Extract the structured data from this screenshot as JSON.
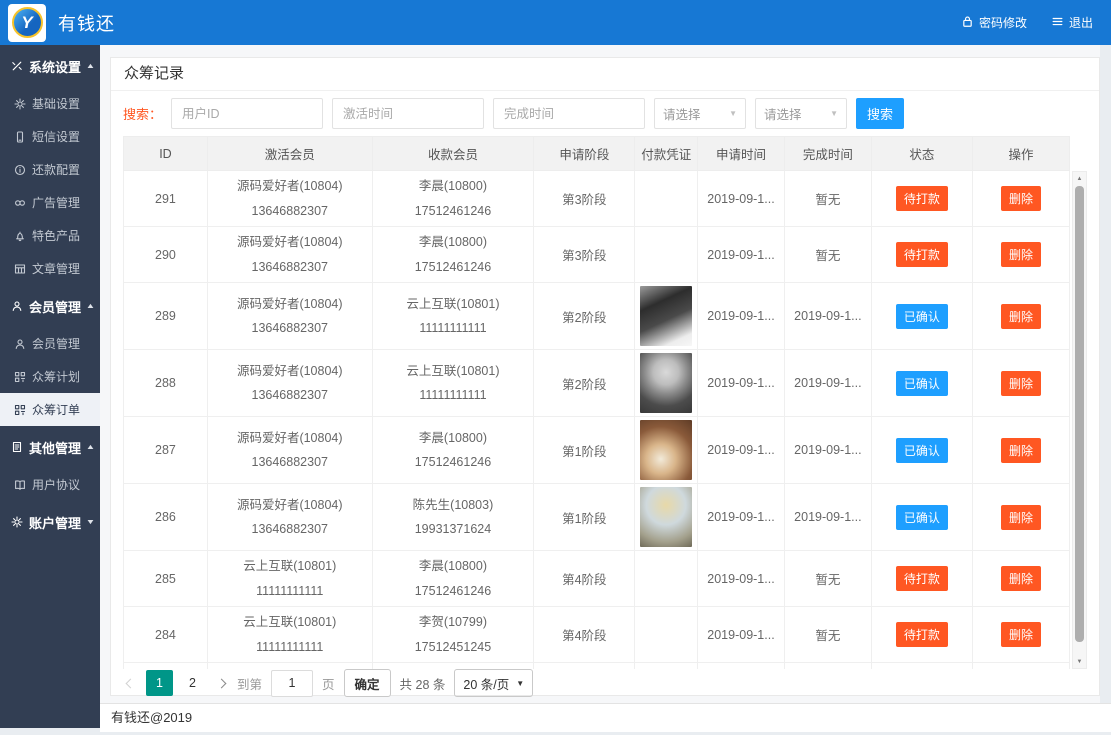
{
  "header": {
    "title": "有钱还",
    "logo_letter": "Y",
    "actions": [
      {
        "key": "change-password",
        "label": "密码修改",
        "icon": "lock-icon"
      },
      {
        "key": "logout",
        "label": "退出",
        "icon": "menu-icon"
      }
    ]
  },
  "sidebar": {
    "items": [
      {
        "key": "system-settings",
        "label": "系统设置",
        "type": "section",
        "icon": "tools",
        "arrow": "up"
      },
      {
        "key": "basic-settings",
        "label": "基础设置",
        "type": "item",
        "icon": "gear"
      },
      {
        "key": "sms-settings",
        "label": "短信设置",
        "type": "item",
        "icon": "phone"
      },
      {
        "key": "repayment-config",
        "label": "还款配置",
        "type": "item",
        "icon": "info"
      },
      {
        "key": "ad-management",
        "label": "广告管理",
        "type": "item",
        "icon": "link"
      },
      {
        "key": "featured-products",
        "label": "特色产品",
        "type": "item",
        "icon": "bell"
      },
      {
        "key": "article-management",
        "label": "文章管理",
        "type": "item",
        "icon": "grid"
      },
      {
        "key": "member-management-group",
        "label": "会员管理",
        "type": "section",
        "icon": "user",
        "arrow": "up"
      },
      {
        "key": "member-management",
        "label": "会员管理",
        "type": "item",
        "icon": "user"
      },
      {
        "key": "crowdfunding-plan",
        "label": "众筹计划",
        "type": "item",
        "icon": "qr"
      },
      {
        "key": "crowdfunding-orders",
        "label": "众筹订单",
        "type": "item",
        "icon": "qr",
        "active": true
      },
      {
        "key": "other-management",
        "label": "其他管理",
        "type": "section",
        "icon": "doc",
        "arrow": "up"
      },
      {
        "key": "user-agreement",
        "label": "用户协议",
        "type": "item",
        "icon": "book"
      },
      {
        "key": "account-management",
        "label": "账户管理",
        "type": "section",
        "icon": "gear",
        "arrow": "down"
      }
    ]
  },
  "page": {
    "title": "众筹记录"
  },
  "search": {
    "label": "搜索：",
    "inputs": [
      {
        "key": "user-id",
        "placeholder": "用户ID"
      },
      {
        "key": "activate-time",
        "placeholder": "激活时间"
      },
      {
        "key": "finish-time",
        "placeholder": "完成时间"
      }
    ],
    "selects": [
      {
        "key": "filter-1",
        "value": "请选择"
      },
      {
        "key": "filter-2",
        "value": "请选择"
      }
    ],
    "button": "搜索"
  },
  "table": {
    "columns": [
      "ID",
      "激活会员",
      "收款会员",
      "申请阶段",
      "付款凭证",
      "申请时间",
      "完成时间",
      "状态",
      "操作"
    ],
    "rows": [
      {
        "id": "291",
        "activator_name": "源码爱好者(10804)",
        "activator_phone": "13646882307",
        "payee_name": "李晨(10800)",
        "payee_phone": "17512461246",
        "stage": "第3阶段",
        "proof": null,
        "apply_time": "2019-09-1...",
        "finish_time": "暂无",
        "status": "待打款",
        "status_type": "pending",
        "action": "删除"
      },
      {
        "id": "290",
        "activator_name": "源码爱好者(10804)",
        "activator_phone": "13646882307",
        "payee_name": "李晨(10800)",
        "payee_phone": "17512461246",
        "stage": "第3阶段",
        "proof": null,
        "apply_time": "2019-09-1...",
        "finish_time": "暂无",
        "status": "待打款",
        "status_type": "pending",
        "action": "删除"
      },
      {
        "id": "289",
        "activator_name": "源码爱好者(10804)",
        "activator_phone": "13646882307",
        "payee_name": "云上互联(10801)",
        "payee_phone": "11111111111",
        "stage": "第2阶段",
        "proof": "photo-1",
        "apply_time": "2019-09-1...",
        "finish_time": "2019-09-1...",
        "status": "已确认",
        "status_type": "confirmed",
        "action": "删除"
      },
      {
        "id": "288",
        "activator_name": "源码爱好者(10804)",
        "activator_phone": "13646882307",
        "payee_name": "云上互联(10801)",
        "payee_phone": "11111111111",
        "stage": "第2阶段",
        "proof": "photo-2",
        "apply_time": "2019-09-1...",
        "finish_time": "2019-09-1...",
        "status": "已确认",
        "status_type": "confirmed",
        "action": "删除"
      },
      {
        "id": "287",
        "activator_name": "源码爱好者(10804)",
        "activator_phone": "13646882307",
        "payee_name": "李晨(10800)",
        "payee_phone": "17512461246",
        "stage": "第1阶段",
        "proof": "photo-3",
        "apply_time": "2019-09-1...",
        "finish_time": "2019-09-1...",
        "status": "已确认",
        "status_type": "confirmed",
        "action": "删除"
      },
      {
        "id": "286",
        "activator_name": "源码爱好者(10804)",
        "activator_phone": "13646882307",
        "payee_name": "陈先生(10803)",
        "payee_phone": "19931371624",
        "stage": "第1阶段",
        "proof": "photo-4",
        "apply_time": "2019-09-1...",
        "finish_time": "2019-09-1...",
        "status": "已确认",
        "status_type": "confirmed",
        "action": "删除"
      },
      {
        "id": "285",
        "activator_name": "云上互联(10801)",
        "activator_phone": "11111111111",
        "payee_name": "李晨(10800)",
        "payee_phone": "17512461246",
        "stage": "第4阶段",
        "proof": null,
        "apply_time": "2019-09-1...",
        "finish_time": "暂无",
        "status": "待打款",
        "status_type": "pending",
        "action": "删除"
      },
      {
        "id": "284",
        "activator_name": "云上互联(10801)",
        "activator_phone": "11111111111",
        "payee_name": "李贺(10799)",
        "payee_phone": "17512451245",
        "stage": "第4阶段",
        "proof": null,
        "apply_time": "2019-09-1...",
        "finish_time": "暂无",
        "status": "待打款",
        "status_type": "pending",
        "action": "删除"
      },
      {
        "id": "",
        "activator_name": "",
        "activator_phone": "",
        "payee_name": "",
        "payee_phone": "",
        "stage": "",
        "proof": "photo-red",
        "apply_time": "",
        "finish_time": "",
        "status": "",
        "status_type": "",
        "action": "",
        "partial": true
      }
    ]
  },
  "pagination": {
    "pages": [
      "1",
      "2"
    ],
    "active_page": "1",
    "goto_label": "到第",
    "goto_value": "1",
    "page_unit": "页",
    "confirm_label": "确定",
    "total_text": "共 28 条",
    "per_page": "20 条/页"
  },
  "footer": {
    "text": "有钱还@2019"
  },
  "colors": {
    "header_blue": "#1778d4",
    "accent_blue": "#1e9fff",
    "orange": "#ff5722",
    "teal": "#009688",
    "sidebar_dark": "#323e53"
  }
}
